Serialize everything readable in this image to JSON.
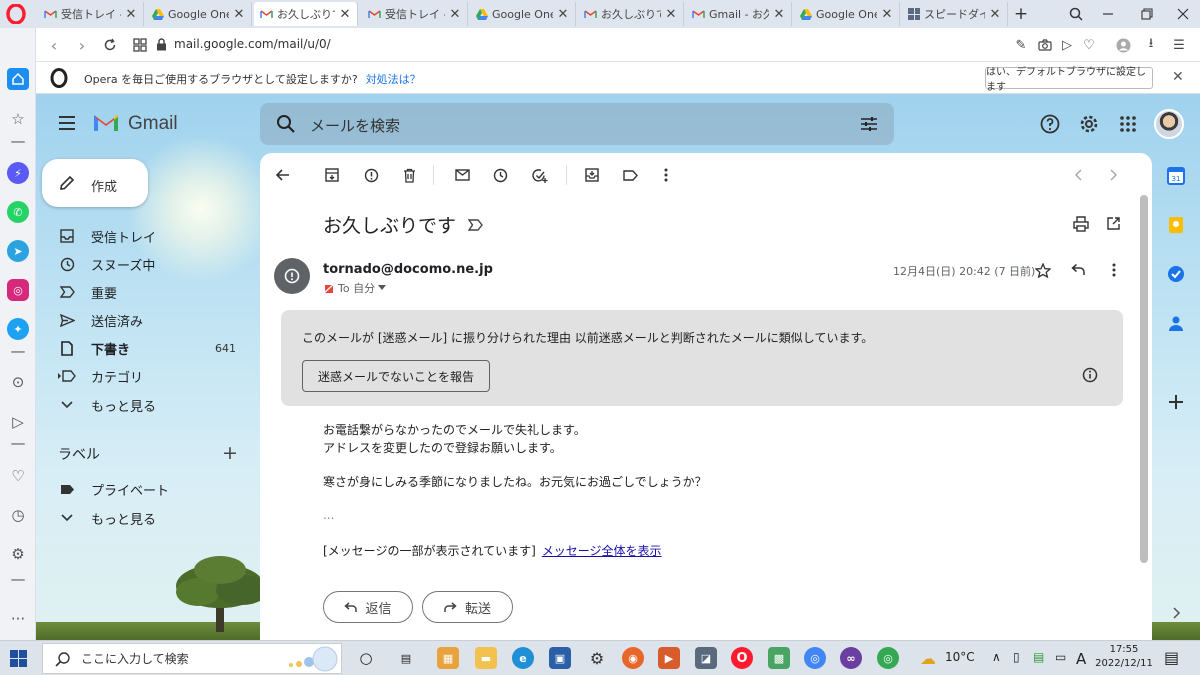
{
  "browser": {
    "tabs": [
      {
        "icon": "gmail",
        "label": "受信トレイ - ah"
      },
      {
        "icon": "drive",
        "label": "Google One"
      },
      {
        "icon": "gmail",
        "label": "お久しぶりです"
      },
      {
        "icon": "gmail",
        "label": "受信トレイ - ah"
      },
      {
        "icon": "drive",
        "label": "Google One"
      },
      {
        "icon": "gmail",
        "label": "お久しぶりです"
      },
      {
        "icon": "gmail",
        "label": "Gmail - お久"
      },
      {
        "icon": "drive",
        "label": "Google One"
      },
      {
        "icon": "grid",
        "label": "スピードダイヤル"
      }
    ],
    "active_tab_index": 2,
    "new_tab": "+",
    "url": "mail.google.com/mail/u/0/",
    "notice": {
      "text": "Opera を毎日ご使用するブラウザとして設定しますか?",
      "link": "対処法は？",
      "button": "はい、デフォルトブラウザに設定します",
      "close": "✕"
    }
  },
  "gmail": {
    "brand": "Gmail",
    "search_placeholder": "メールを検索",
    "compose": "作成",
    "nav": [
      {
        "icon": "inbox-icon",
        "label": "受信トレイ",
        "count": ""
      },
      {
        "icon": "snooze-icon",
        "label": "スヌーズ中",
        "count": ""
      },
      {
        "icon": "important-icon",
        "label": "重要",
        "count": ""
      },
      {
        "icon": "sent-icon",
        "label": "送信済み",
        "count": ""
      },
      {
        "icon": "draft-icon",
        "label": "下書き",
        "count": "641"
      },
      {
        "icon": "category-icon",
        "label": "カテゴリ",
        "count": ""
      },
      {
        "icon": "expand-icon",
        "label": "もっと見る",
        "count": ""
      }
    ],
    "labels_title": "ラベル",
    "labels_add": "+",
    "labels": [
      {
        "icon": "label-icon",
        "label": "プライベート"
      },
      {
        "icon": "expand-icon",
        "label": "もっと見る"
      }
    ],
    "message": {
      "subject": "お久しぶりです",
      "sender": "tornado@docomo.ne.jp",
      "to": "To 自分",
      "date": "12月4日(日) 20:42 (7 日前)",
      "spam_notice": "このメールが [迷惑メール] に振り分けられた理由 以前迷惑メールと判断されたメールに類似しています。",
      "spam_button": "迷惑メールでないことを報告",
      "body": [
        "お電話繋がらなかったのでメールで失礼します。",
        "アドレスを変更したので登録お願いします。",
        "寒さが身にしみる季節になりましたね。お元気にお過ごしでしょうか？"
      ],
      "ellipsis": "...",
      "clipped_text": "[メッセージの一部が表示されています]",
      "clipped_link": "メッセージ全体を表示",
      "reply": "返信",
      "forward": "転送"
    }
  },
  "taskbar": {
    "search_placeholder": "ここに入力して検索",
    "weather": "10°C",
    "ime": "A",
    "time": "17:55",
    "date": "2022/12/11"
  },
  "colors": {
    "accent": "#1a73e8",
    "opera_red": "#ff1b2d",
    "gmail_red": "#ea4335",
    "spam_box": "#e1e1e1"
  }
}
